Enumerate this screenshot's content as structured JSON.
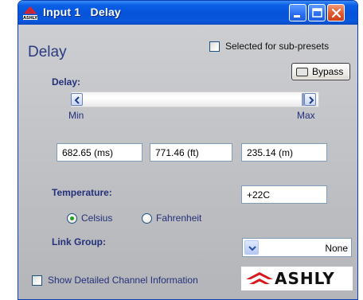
{
  "window": {
    "title": "Input 1   Delay",
    "title_bar_color": "#0553d8",
    "close_button_color": "#e0572b",
    "app_icon": "ashly-logo-icon"
  },
  "header": {
    "heading": "Delay",
    "sub_presets_label": "Selected for sub-presets",
    "sub_presets_checked": false,
    "bypass_label": "Bypass"
  },
  "delay": {
    "label": "Delay:",
    "slider_min_label": "Min",
    "slider_max_label": "Max",
    "ms": "682.65 (ms)",
    "ft": "771.46 (ft)",
    "m": "235.14 (m)"
  },
  "temperature": {
    "label": "Temperature:",
    "value": "+22C",
    "options": [
      "Celsius",
      "Fahrenheit"
    ],
    "selected": "Celsius",
    "selected_color": "#21a121"
  },
  "link_group": {
    "label": "Link Group:",
    "value": "None"
  },
  "footer": {
    "show_details_label": "Show Detailed Channel Information",
    "show_details_checked": false,
    "brand": "ASHLY",
    "brand_accent": "#d8181b"
  }
}
